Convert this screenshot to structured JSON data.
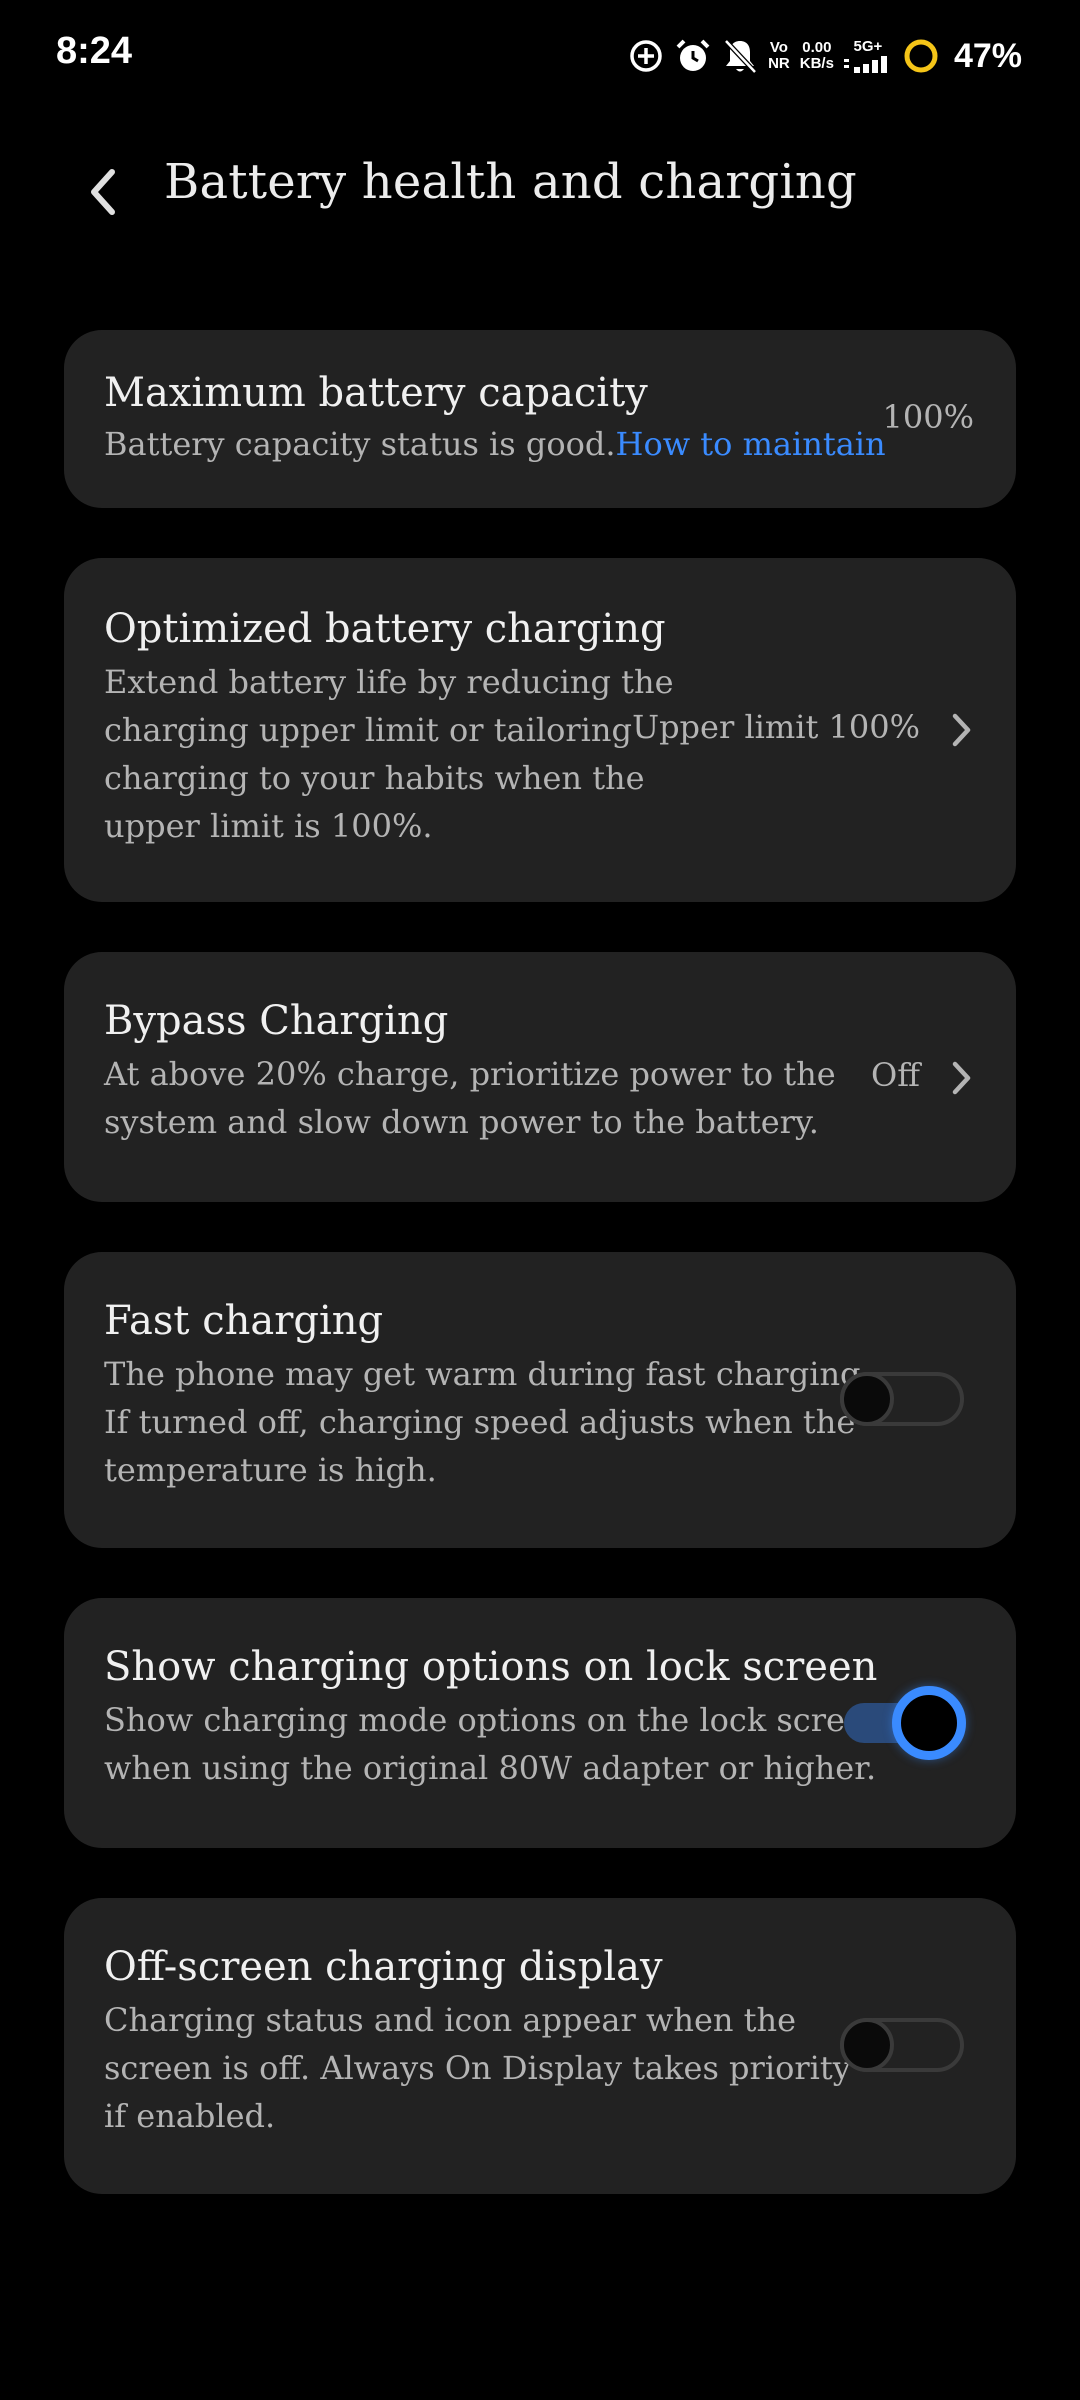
{
  "status_bar": {
    "time": "8:24",
    "network_top": "Vo",
    "network_bottom": "NR",
    "speed_value": "0.00",
    "speed_unit": "KB/s",
    "signal_label": "5G+",
    "battery_percent": "47%",
    "icons": [
      "add-circle-icon",
      "alarm-icon",
      "notifications-off-icon",
      "signal-bars-icon",
      "battery-ring-icon"
    ]
  },
  "header": {
    "back_icon": "chevron-left-icon",
    "title": "Battery health and charging"
  },
  "cards": {
    "capacity": {
      "title": "Maximum battery capacity",
      "desc": "Battery capacity status is good.",
      "link": "How to maintain",
      "value": "100%"
    },
    "optimized": {
      "title": "Optimized battery charging",
      "desc_lines": [
        "Extend battery life by reducing the",
        "charging upper limit or tailoring",
        "charging to your habits when the",
        "upper limit is 100%."
      ],
      "value": "Upper limit 100%"
    },
    "bypass": {
      "title": "Bypass Charging",
      "desc_lines": [
        "At above 20% charge, prioritize power to the",
        "system and slow down power to the battery."
      ],
      "value": "Off"
    },
    "fast": {
      "title": "Fast charging",
      "desc_lines": [
        "The phone may get warm during fast charging.",
        "If turned off, charging speed adjusts when the",
        "temperature is high."
      ],
      "enabled": false
    },
    "lockscreen": {
      "title": "Show charging options on lock screen",
      "desc_lines": [
        "Show charging mode options on the lock screen",
        "when using the original 80W adapter or higher."
      ],
      "enabled": true
    },
    "offscreen": {
      "title": "Off-screen charging display",
      "desc_lines": [
        "Charging status and icon appear when the",
        "screen is off. Always On Display takes priority",
        "if enabled."
      ],
      "enabled": false
    }
  },
  "colors": {
    "background": "#000000",
    "card": "#222222",
    "accent": "#3a8bff",
    "battery_ring": "#f5c518"
  }
}
